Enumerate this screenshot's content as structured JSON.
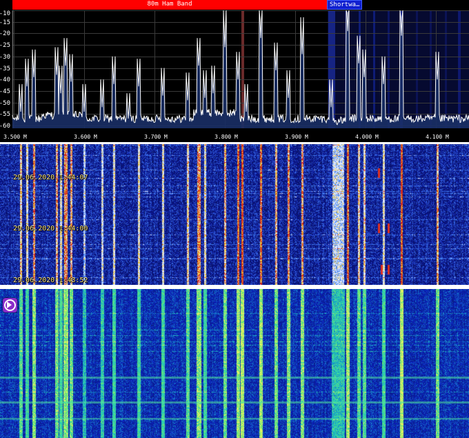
{
  "bands": [
    {
      "label": "80m Ham Band",
      "color": "#ff0000"
    },
    {
      "label": "Shortwa…",
      "color": "#1020d0"
    }
  ],
  "spectrum": {
    "y_labels": [
      "-10",
      "-15",
      "-20",
      "-25",
      "-30",
      "-35",
      "-40",
      "-45",
      "-50",
      "-55",
      "-60"
    ],
    "x_labels": [
      "3.500 M",
      "3.600 M",
      "3.700 M",
      "3.800 M",
      "3.900 M",
      "4.000 M",
      "4.100 M"
    ],
    "trace_color": "#ffffff",
    "fill_color": "#1a2f66",
    "grid_color": "#3a3a3a"
  },
  "waterfall": {
    "timestamps": [
      "29.06.2020 1:44:07",
      "29.06.2020 1:44:00",
      "29.06.2020 1:43:52"
    ]
  },
  "player": {
    "icon": "play-circle-icon"
  }
}
